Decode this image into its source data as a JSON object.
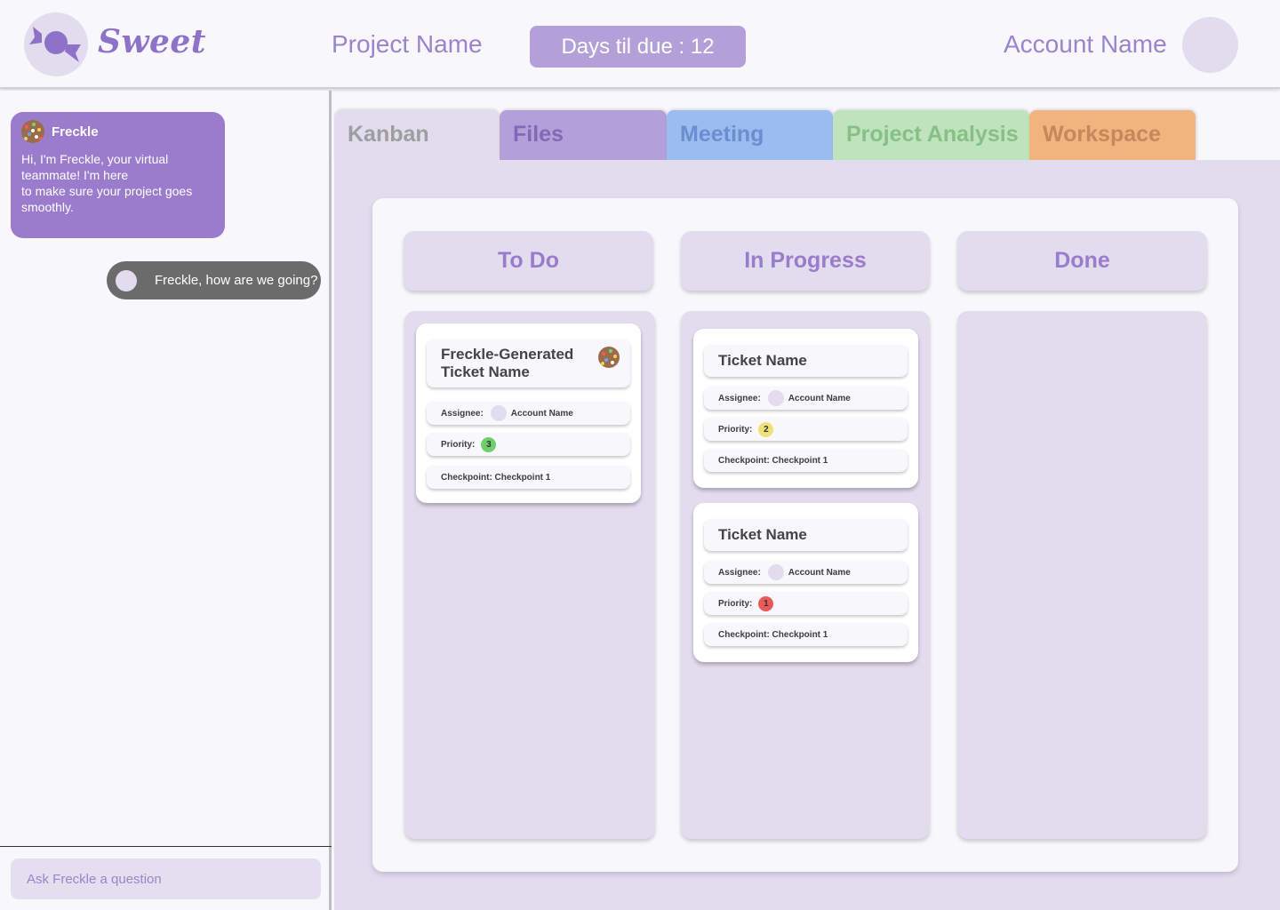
{
  "header": {
    "logo_text": "Sweet",
    "project_name": "Project Name",
    "days_label": "Days til due : 12",
    "account_name": "Account Name"
  },
  "chat": {
    "bot_name": "Freckle",
    "bot_message": "Hi, I'm Freckle, your virtual\nteammate! I'm here\nto make sure your project goes\nsmoothly.",
    "user_message": "Freckle, how are we going?",
    "input_placeholder": "Ask Freckle a question"
  },
  "tabs": [
    {
      "label": "Kanban",
      "color": "#e2dcef",
      "active": true
    },
    {
      "label": "Files",
      "color": "#b3a0d9"
    },
    {
      "label": "Meeting",
      "color": "#9bbcef"
    },
    {
      "label": "Project Analysis",
      "color": "#bfe3bd"
    },
    {
      "label": "Workspace",
      "color": "#f0b47f"
    }
  ],
  "columns": [
    {
      "title": "To Do",
      "tickets": [
        {
          "name": "Freckle-Generated Ticket Name",
          "name_line1": "Freckle-Generated",
          "name_line2": "Ticket Name",
          "assignee_label": "Assignee:",
          "assignee": "Account Name",
          "priority_label": "Priority:",
          "priority": "3",
          "priority_color": "#6ccf6c",
          "checkpoint": "Checkpoint: Checkpoint 1",
          "freckle_icon": "freckle-icon"
        }
      ]
    },
    {
      "title": "In Progress",
      "tickets": [
        {
          "name": "Ticket Name",
          "assignee_label": "Assignee:",
          "assignee": "Account Name",
          "priority_label": "Priority:",
          "priority": "2",
          "priority_color": "#f0e07a",
          "checkpoint": "Checkpoint: Checkpoint 1"
        },
        {
          "name": "Ticket Name",
          "assignee_label": "Assignee:",
          "assignee": "Account Name",
          "priority_label": "Priority:",
          "priority": "1",
          "priority_color": "#e85b5b",
          "checkpoint": "Checkpoint: Checkpoint 1"
        }
      ]
    },
    {
      "title": "Done",
      "tickets": []
    }
  ],
  "colors": {
    "brand": "#8e72c9",
    "panel": "#e2dcef",
    "background": "#f8f7fc"
  }
}
